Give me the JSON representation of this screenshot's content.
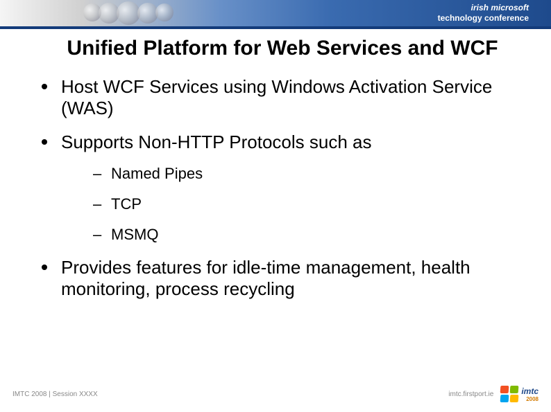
{
  "header": {
    "line1": "irish microsoft",
    "line2": "technology conference"
  },
  "title": "Unified Platform for Web Services and WCF",
  "bullets": [
    {
      "text": "Host WCF Services using Windows Activation Service (WAS)"
    },
    {
      "text": "Supports Non-HTTP Protocols such as",
      "sub": [
        "Named Pipes",
        "TCP",
        "MSMQ"
      ]
    },
    {
      "text": "Provides features for idle-time management, health monitoring, process recycling"
    }
  ],
  "footer": {
    "left": "IMTC 2008 | Session XXXX",
    "url": "imtc.firstport.ie",
    "logo_main": "imtc",
    "logo_sub": "2008"
  }
}
